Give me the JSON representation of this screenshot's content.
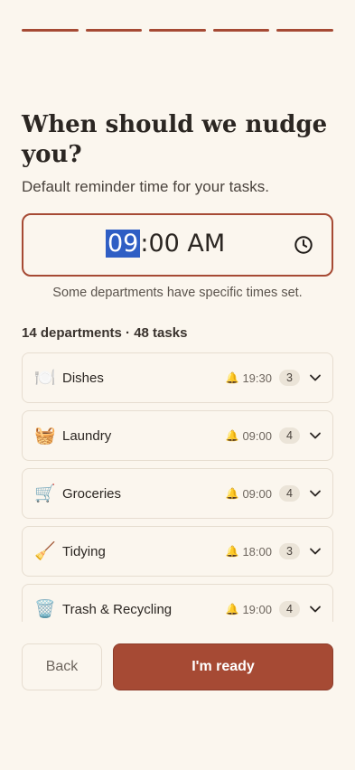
{
  "progress": {
    "steps_total": 5,
    "steps_completed": 5,
    "color": "#a64a34"
  },
  "header": {
    "title": "When should we nudge you?",
    "subtitle": "Default reminder time for your tasks."
  },
  "time_picker": {
    "hour": "09",
    "rest": ":00 AM",
    "clock_icon": "clock-icon",
    "border_color": "#a64a34",
    "selection_color": "#2f5ec4"
  },
  "hint": "Some departments have specific times set.",
  "summary": "14 departments · 48 tasks",
  "departments": [
    {
      "emoji": "🍽️",
      "name": "Dishes",
      "bell": "🔔",
      "time": "19:30",
      "count": "3"
    },
    {
      "emoji": "🧺",
      "name": "Laundry",
      "bell": "🔔",
      "time": "09:00",
      "count": "4"
    },
    {
      "emoji": "🛒",
      "name": "Groceries",
      "bell": "🔔",
      "time": "09:00",
      "count": "4"
    },
    {
      "emoji": "🧹",
      "name": "Tidying",
      "bell": "🔔",
      "time": "18:00",
      "count": "3"
    },
    {
      "emoji": "🗑️",
      "name": "Trash & Recycling",
      "bell": "🔔",
      "time": "19:00",
      "count": "4"
    }
  ],
  "footer": {
    "back_label": "Back",
    "ready_label": "I'm ready",
    "accent": "#a64a34"
  }
}
